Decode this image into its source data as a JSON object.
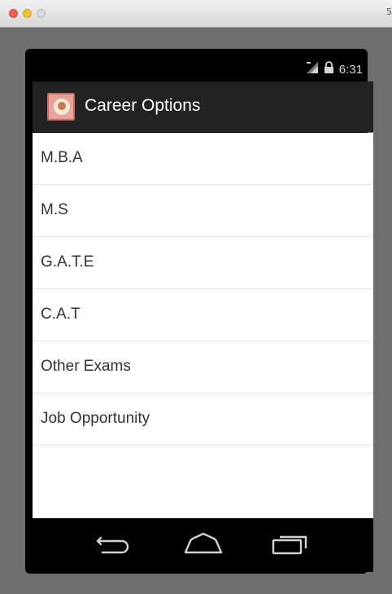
{
  "window": {
    "edge_text": "5"
  },
  "status_bar": {
    "time": "6:31",
    "icons": [
      "signal-icon",
      "lock-icon"
    ]
  },
  "action_bar": {
    "title": "Career Options",
    "icon": "app-launcher-icon"
  },
  "list": {
    "items": [
      {
        "label": "M.B.A"
      },
      {
        "label": "M.S"
      },
      {
        "label": "G.A.T.E"
      },
      {
        "label": "C.A.T"
      },
      {
        "label": "Other Exams"
      },
      {
        "label": "Job Opportunity"
      }
    ]
  },
  "nav_bar": {
    "buttons": [
      "back-icon",
      "home-icon",
      "recent-apps-icon"
    ]
  },
  "colors": {
    "action_bar_bg": "#222222",
    "list_bg": "#ffffff",
    "text": "#333333"
  }
}
